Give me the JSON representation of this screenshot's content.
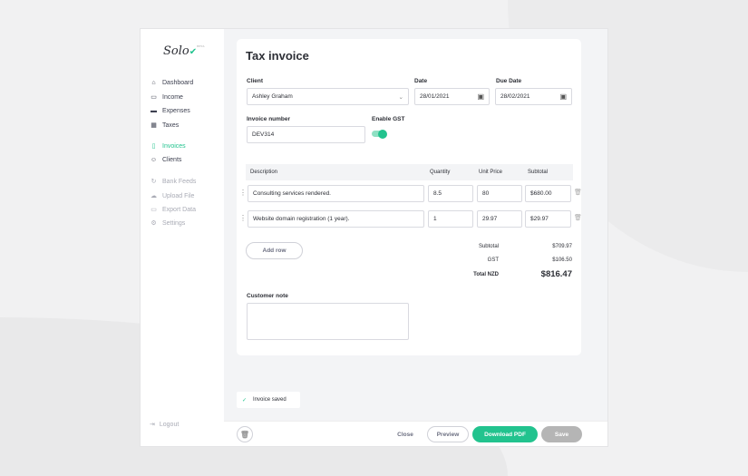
{
  "brand": {
    "name": "Solo",
    "badge": "BETA"
  },
  "sidebar": {
    "items": [
      {
        "label": "Dashboard",
        "icon": "home-icon"
      },
      {
        "label": "Income",
        "icon": "folder-icon"
      },
      {
        "label": "Expenses",
        "icon": "card-icon"
      },
      {
        "label": "Taxes",
        "icon": "calculator-icon"
      },
      {
        "label": "Invoices",
        "icon": "invoice-icon"
      },
      {
        "label": "Clients",
        "icon": "users-icon"
      },
      {
        "label": "Bank Feeds",
        "icon": "sync-icon"
      },
      {
        "label": "Upload File",
        "icon": "upload-icon"
      },
      {
        "label": "Export Data",
        "icon": "export-icon"
      },
      {
        "label": "Settings",
        "icon": "gear-icon"
      }
    ],
    "logout": "Logout"
  },
  "invoice": {
    "title": "Tax invoice",
    "client_label": "Client",
    "client": "Ashley Graham",
    "date_label": "Date",
    "date": "28/01/2021",
    "due_label": "Due Date",
    "due": "28/02/2021",
    "number_label": "Invoice number",
    "number": "DEV314",
    "gst_label": "Enable GST",
    "gst_enabled": true,
    "columns": [
      "Description",
      "Quantity",
      "Unit Price",
      "Subtotal"
    ],
    "rows": [
      {
        "description": "Consulting services rendered.",
        "quantity": "8.5",
        "unit_price": "80",
        "subtotal": "$680.00"
      },
      {
        "description": "Website domain registration (1 year).",
        "quantity": "1",
        "unit_price": "29.97",
        "subtotal": "$29.97"
      }
    ],
    "add_row": "Add row",
    "totals": {
      "subtotal_label": "Subtotal",
      "subtotal": "$709.97",
      "gst_label": "GST",
      "gst": "$106.50",
      "total_label": "Total NZD",
      "total": "$816.47"
    },
    "note_label": "Customer note",
    "note": ""
  },
  "toast": "Invoice saved",
  "footer": {
    "close": "Close",
    "preview": "Preview",
    "download": "Download PDF",
    "save": "Save"
  },
  "colors": {
    "accent": "#22c38e",
    "save_disabled": "#b5b5b5"
  }
}
